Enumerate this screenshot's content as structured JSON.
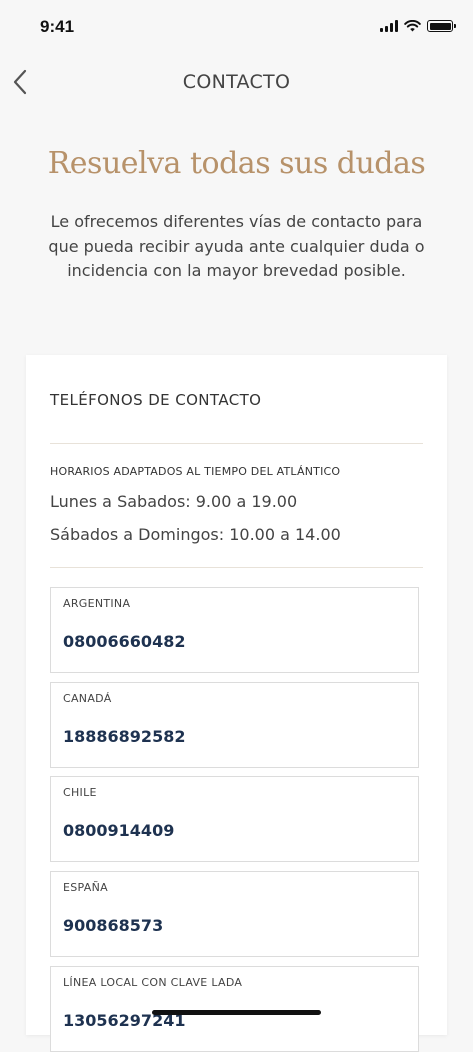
{
  "status_bar": {
    "time": "9:41"
  },
  "nav": {
    "title": "CONTACTO"
  },
  "hero": {
    "title": "Resuelva todas sus dudas",
    "description": "Le ofrecemos diferentes vías de contacto para que pueda recibir ayuda ante cualquier duda o incidencia con la mayor brevedad posible."
  },
  "contact": {
    "section_title": "TELÉFONOS DE CONTACTO",
    "hours_label": "HORARIOS ADAPTADOS AL TIEMPO DEL ATLÁNTICO",
    "hours": [
      "Lunes a Sabados: 9.00 a 19.00",
      "Sábados a Domingos: 10.00 a 14.00"
    ],
    "phones": [
      {
        "country": "ARGENTINA",
        "number": "08006660482"
      },
      {
        "country": "CANADÁ",
        "number": "18886892582"
      },
      {
        "country": "CHILE",
        "number": "0800914409"
      },
      {
        "country": "ESPAÑA",
        "number": "900868573"
      },
      {
        "country": "LÍNEA LOCAL CON CLAVE LADA",
        "number": "13056297241"
      }
    ]
  },
  "colors": {
    "accent": "#b7926a",
    "phone_number": "#1e3250",
    "background": "#f7f7f7"
  },
  "icons": {
    "back": "chevron-left-icon",
    "signal": "cellular-signal-icon",
    "wifi": "wifi-icon",
    "battery": "battery-icon"
  }
}
